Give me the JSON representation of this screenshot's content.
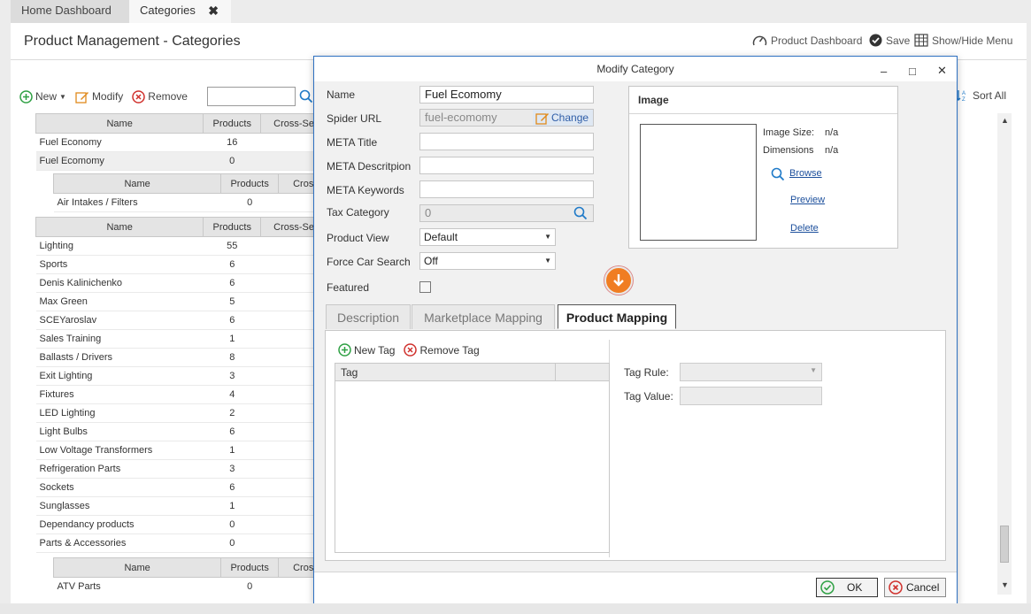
{
  "tabs": [
    {
      "label": "Home Dashboard"
    },
    {
      "label": "Categories",
      "close": "✖"
    }
  ],
  "page": {
    "title": "Product Management - Categories",
    "actions": {
      "dashboard": "Product Dashboard",
      "save": "Save",
      "menu": "Show/Hide Menu"
    }
  },
  "toolbar": {
    "new": "New",
    "modify": "Modify",
    "remove": "Remove",
    "sort_all": "Sort All"
  },
  "grid": {
    "headers": {
      "name": "Name",
      "products": "Products",
      "cross": "Cross-Se",
      "cross_short": "Cros"
    },
    "top_rows": [
      {
        "name": "Fuel Economy",
        "products": "16"
      },
      {
        "name": "Fuel Ecomomy",
        "products": "0"
      }
    ],
    "sub1_rows": [
      {
        "name": "Air Intakes / Filters",
        "products": "0"
      }
    ],
    "rows": [
      {
        "name": "Lighting",
        "products": "55"
      },
      {
        "name": "Sports",
        "products": "6"
      },
      {
        "name": "Denis Kalinichenko",
        "products": "6"
      },
      {
        "name": "Max Green",
        "products": "5"
      },
      {
        "name": "SCEYaroslav",
        "products": "6"
      },
      {
        "name": "Sales Training",
        "products": "1"
      },
      {
        "name": "Ballasts / Drivers",
        "products": "8"
      },
      {
        "name": "Exit Lighting",
        "products": "3"
      },
      {
        "name": "Fixtures",
        "products": "4"
      },
      {
        "name": "LED Lighting",
        "products": "2"
      },
      {
        "name": "Light Bulbs",
        "products": "6"
      },
      {
        "name": "Low Voltage Transformers",
        "products": "1"
      },
      {
        "name": "Refrigeration Parts",
        "products": "3"
      },
      {
        "name": "Sockets",
        "products": "6"
      },
      {
        "name": "Sunglasses",
        "products": "1"
      },
      {
        "name": "Dependancy products",
        "products": "0"
      },
      {
        "name": "Parts & Accessories",
        "products": "0"
      }
    ],
    "sub2_rows": [
      {
        "name": "ATV Parts",
        "products": "0"
      }
    ]
  },
  "modal": {
    "title": "Modify Category",
    "fields": {
      "name_label": "Name",
      "name_value": "Fuel Ecomomy",
      "spider_label": "Spider URL",
      "spider_value": "fuel-ecomomy",
      "change": "Change",
      "meta_title_label": "META Title",
      "meta_desc_label": "META Descritpion",
      "meta_kw_label": "META Keywords",
      "tax_label": "Tax Category",
      "tax_value": "0",
      "view_label": "Product View",
      "view_value": "Default",
      "force_label": "Force Car Search",
      "force_value": "Off",
      "featured_label": "Featured"
    },
    "image": {
      "title": "Image",
      "size_label": "Image Size:",
      "size_value": "n/a",
      "dims_label": "Dimensions",
      "dims_value": "n/a",
      "browse": "Browse",
      "preview": "Preview",
      "delete": "Delete"
    },
    "subtabs": [
      "Description",
      "Marketplace Mapping",
      "Product Mapping"
    ],
    "mapping": {
      "new_tag": "New Tag",
      "remove_tag": "Remove Tag",
      "tag_col": "Tag",
      "tag_rule": "Tag Rule:",
      "tag_value": "Tag Value:"
    },
    "buttons": {
      "ok": "OK",
      "cancel": "Cancel"
    }
  },
  "colors": {
    "accent_orange": "#f07d22",
    "accent_blue": "#2f71c1",
    "ok_green": "#2ea043",
    "cancel_red": "#d0312d"
  }
}
